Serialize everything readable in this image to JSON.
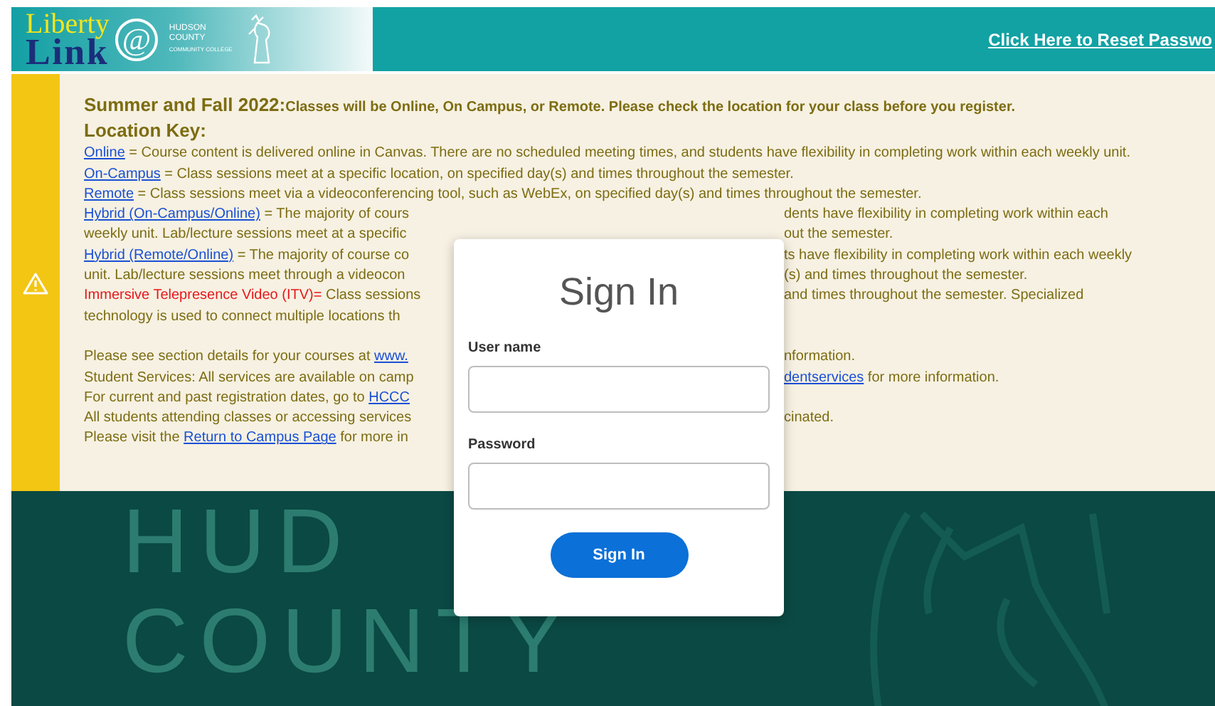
{
  "header": {
    "logo": {
      "top": "Liberty",
      "bottom": "Link",
      "at": "@",
      "college": [
        "HUDSON",
        "COUNTY",
        "COMMUNITY COLLEGE"
      ]
    },
    "reset_link": "Click Here to Reset Passwo"
  },
  "notice": {
    "heading": {
      "lead": "Summer and Fall 2022:",
      "text": "Classes will be Online, On Campus, or Remote. Please check the location for your class before you register."
    },
    "key_title": "Location Key:",
    "entries": [
      {
        "link": "Online",
        "text": " = Course content is delivered online in Canvas. There are no scheduled meeting times, and students have flexibility in completing work within each weekly unit."
      },
      {
        "link": "On-Campus",
        "text": " = Class sessions meet at a specific location, on specified day(s) and times throughout the semester."
      },
      {
        "link": "Remote",
        "text": " = Class sessions meet via a videoconferencing tool, such as WebEx, on specified day(s) and times throughout the semester."
      }
    ],
    "split_lines": [
      {
        "left": [
          {
            "kind": "link",
            "text": "Hybrid (On-Campus/Online)"
          },
          {
            "kind": "plain",
            "text": " = The majority of cours"
          }
        ],
        "right": [
          {
            "kind": "plain",
            "text": "dents have flexibility in completing work within each"
          }
        ]
      },
      {
        "left": [
          {
            "kind": "plain",
            "text": "weekly unit. Lab/lecture sessions meet at a specific"
          }
        ],
        "right": [
          {
            "kind": "plain",
            "text": "out the semester."
          }
        ]
      },
      {
        "left": [
          {
            "kind": "link",
            "text": "Hybrid (Remote/Online)"
          },
          {
            "kind": "plain",
            "text": " = The majority of course co"
          }
        ],
        "right": [
          {
            "kind": "plain",
            "text": "ts have flexibility in completing work within each weekly"
          }
        ]
      },
      {
        "left": [
          {
            "kind": "plain",
            "text": "unit. Lab/lecture sessions meet through a videocon"
          }
        ],
        "right": [
          {
            "kind": "plain",
            "text": "(s) and times throughout the semester."
          }
        ]
      },
      {
        "left": [
          {
            "kind": "alert",
            "text": "Immersive Telepresence Video (ITV)="
          },
          {
            "kind": "plain",
            "text": " Class sessions"
          }
        ],
        "right": [
          {
            "kind": "plain",
            "text": "and times throughout the semester. Specialized"
          }
        ]
      },
      {
        "left": [
          {
            "kind": "plain",
            "text": "technology is used to connect multiple locations th"
          }
        ]
      },
      {
        "gap_before": true,
        "left": [
          {
            "kind": "plain",
            "text": "Please see section details for your courses at "
          },
          {
            "kind": "link",
            "text": "www."
          }
        ],
        "right": [
          {
            "kind": "plain",
            "text": "nformation."
          }
        ]
      },
      {
        "left": [
          {
            "kind": "plain",
            "text": "Student Services: All services are available on camp"
          }
        ],
        "right": [
          {
            "kind": "link",
            "text": "dentservices"
          },
          {
            "kind": "plain",
            "text": " for more information."
          }
        ]
      },
      {
        "left": [
          {
            "kind": "plain",
            "text": "For current and past registration dates, go to "
          },
          {
            "kind": "link",
            "text": "HCCC"
          }
        ]
      },
      {
        "left": [
          {
            "kind": "plain",
            "text": "All students attending classes or accessing services"
          }
        ],
        "right": [
          {
            "kind": "plain",
            "text": "cinated."
          }
        ]
      },
      {
        "left": [
          {
            "kind": "plain",
            "text": "Please visit the "
          },
          {
            "kind": "link",
            "text": "Return to Campus Page"
          },
          {
            "kind": "plain",
            "text": " for more in"
          }
        ]
      }
    ]
  },
  "background": {
    "lettering": [
      "HUD",
      "COUNTY"
    ]
  },
  "sign_in": {
    "title": "Sign In",
    "fields": [
      {
        "label": "User name"
      },
      {
        "label": "Password"
      }
    ],
    "button": "Sign In"
  }
}
